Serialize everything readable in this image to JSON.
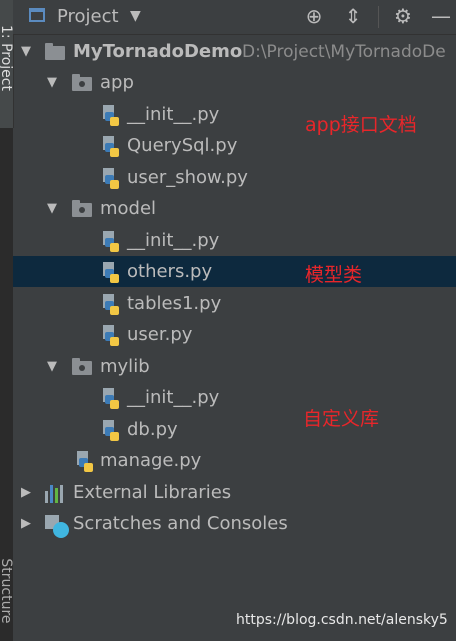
{
  "sidebar": {
    "project_tab": "1: Project",
    "structure_tab": "Structure"
  },
  "header": {
    "title": "Project",
    "icons": [
      "globe-target-icon",
      "collapse-all-icon",
      "gear-icon",
      "minimize-icon"
    ]
  },
  "tree": {
    "root": {
      "name": "MyTornadoDemo",
      "path": "D:\\Project\\MyTornadoDe"
    },
    "app": {
      "name": "app",
      "files": [
        "__init__.py",
        "QuerySql.py",
        "user_show.py"
      ]
    },
    "model": {
      "name": "model",
      "files": [
        "__init__.py",
        "others.py",
        "tables1.py",
        "user.py"
      ]
    },
    "mylib": {
      "name": "mylib",
      "files": [
        "__init__.py",
        "db.py"
      ]
    },
    "root_file": "manage.py",
    "external_libraries": "External Libraries",
    "scratches": "Scratches and Consoles"
  },
  "annotations": {
    "app_note": "app接口文档",
    "model_note": "模型类",
    "mylib_note": "自定义库"
  },
  "watermark": "https://blog.csdn.net/alensky5",
  "colors": {
    "background": "#3c3f41",
    "selection": "#0d293e",
    "annotation": "#e8262a",
    "text": "#bbbbbb"
  }
}
